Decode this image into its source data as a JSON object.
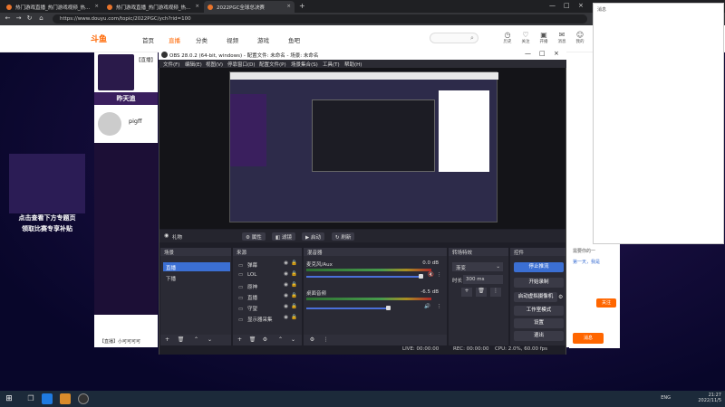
{
  "browser": {
    "tabs": [
      {
        "label": "热门游戏直播_热门游戏视频_热..."
      },
      {
        "label": "热门游戏直播_热门游戏视频_热..."
      },
      {
        "label": "2022PGC全球总决赛"
      }
    ],
    "new_tab": "+",
    "url": "https://www.douyu.com/topic/2022PGC/ych?rid=100"
  },
  "site": {
    "logo": "斗鱼",
    "nav": [
      "首页",
      "直播",
      "分类",
      "视频",
      "游戏",
      "鱼吧"
    ],
    "search_placeholder": "",
    "header_icons": [
      "历史",
      "关注",
      "开播",
      "消息",
      "我的"
    ],
    "room_title": "【直播】",
    "room_caption": "昨天追",
    "streamer": "pigff",
    "ad_text_1": "点击查看下方专题页",
    "ad_text_2": "领取比赛专享补贴",
    "left_bottom": "【直播】小可可可可",
    "right_btn_1": "关注",
    "right_btn_2": "消息",
    "popup_title": "消息",
    "right_text_1": "第一天，我是",
    "right_text_2": "需要你的一"
  },
  "obs": {
    "title": "OBS 28.0.2 (64-bit, windows) - 配置文件: 未命名 - 场景: 未命名",
    "menu": [
      "文件(F)",
      "编辑(E)",
      "视图(V)",
      "停靠窗口(D)",
      "配置文件(P)",
      "场景集合(S)",
      "工具(T)",
      "帮助(H)"
    ],
    "source_toolbar": {
      "label": "礼物",
      "props": "属性",
      "filters": "滤镜",
      "activate": "启动",
      "refresh": "刷新"
    },
    "scenes": {
      "title": "场景",
      "items": [
        "直播",
        "下播"
      ]
    },
    "sources": {
      "title": "来源",
      "items": [
        "弹幕",
        "LOL",
        "原神",
        "直播",
        "守望",
        "显示器采集"
      ]
    },
    "mixer": {
      "title": "混音器",
      "channels": [
        {
          "name": "麦克风/Aux",
          "db": "0.0 dB"
        },
        {
          "name": "桌面音频",
          "db": "-6.5 dB"
        }
      ]
    },
    "transitions": {
      "title": "转场特效",
      "type": "渐变",
      "duration_label": "时长",
      "duration": "300 ms"
    },
    "controls": {
      "title": "控件",
      "buttons": [
        "停止推流",
        "开始录制",
        "启动虚拟摄像机",
        "工作室模式",
        "设置",
        "退出"
      ]
    },
    "status": {
      "live": "LIVE: 00:00:00",
      "rec": "REC: 00:00:00",
      "cpu": "CPU: 2.0%, 60.00 fps"
    }
  },
  "taskbar": {
    "time": "21:27",
    "date": "2022/11/5",
    "lang": "ENG"
  }
}
